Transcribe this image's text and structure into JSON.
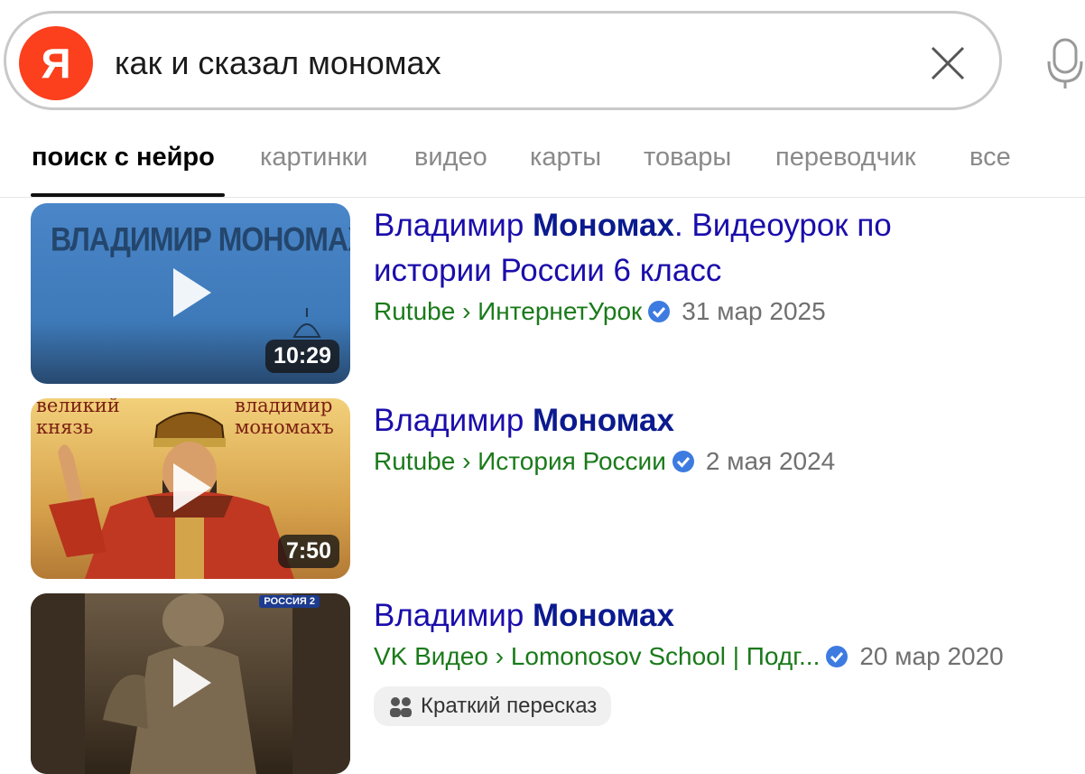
{
  "search": {
    "logo_letter": "Я",
    "query": "как и сказал мономах"
  },
  "tabs": [
    {
      "label": "поиск с нейро",
      "active": true
    },
    {
      "label": "картинки"
    },
    {
      "label": "видео"
    },
    {
      "label": "карты"
    },
    {
      "label": "товары"
    },
    {
      "label": "переводчик"
    },
    {
      "label": "все"
    }
  ],
  "results": [
    {
      "title_pre": "Владимир ",
      "title_bold": "Мономах",
      "title_post": ". Видеоурок по истории России 6 класс",
      "source": "Rutube › ИнтернетУрок",
      "date": "31 мар 2025",
      "duration": "10:29",
      "thumb_text": "ВЛАДИМИР МОНОМАХ"
    },
    {
      "title_pre": "Владимир ",
      "title_bold": "Мономах",
      "title_post": "",
      "source": "Rutube › История России",
      "date": "2 мая 2024",
      "duration": "7:50",
      "thumb_text_left": "великий князь",
      "thumb_text_right": "владимир мономахъ"
    },
    {
      "title_pre": "Владимир ",
      "title_bold": "Мономах",
      "title_post": "",
      "source": "VK Видео › Lomonosov School | Подг...",
      "date": "20 мар 2020",
      "channel_badge": "РОССИЯ 2",
      "summary_label": "Краткий пересказ"
    }
  ],
  "colors": {
    "brand": "#fc3f1d",
    "link": "#1a0dab",
    "source": "#1a7a1a",
    "verified": "#3d7be0"
  }
}
